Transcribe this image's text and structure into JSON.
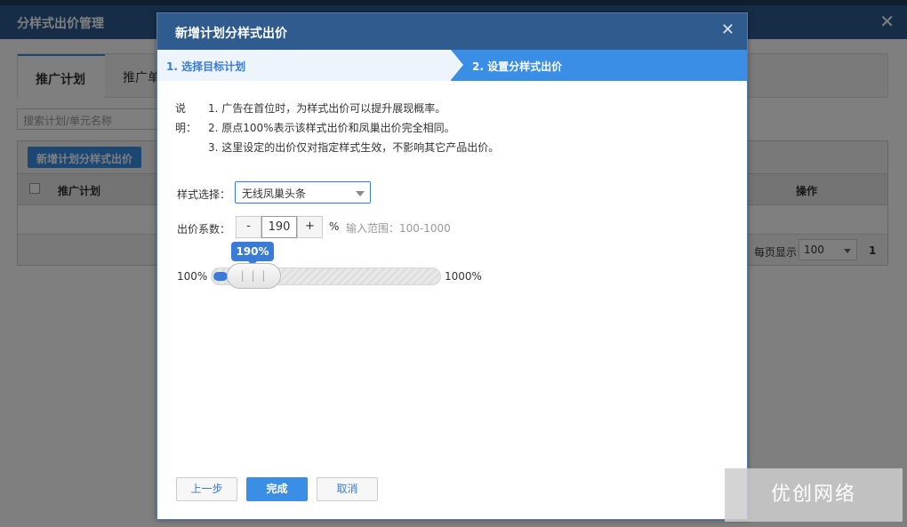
{
  "background": {
    "header_title": "分样式出价管理",
    "close_glyph": "✕",
    "tabs": [
      {
        "label": "推广计划"
      },
      {
        "label": "推广单"
      }
    ],
    "search_placeholder": "搜索计划/单元名称",
    "add_button_label": "新增计划分样式出价",
    "columns": [
      "推广计划",
      "操作"
    ],
    "per_page_label": "每页显示",
    "per_page_value": "100",
    "page_number": "1"
  },
  "modal": {
    "title": "新增计划分样式出价",
    "close_glyph": "✕",
    "steps": [
      {
        "label": "1. 选择目标计划",
        "active": false
      },
      {
        "label": "2. 设置分样式出价",
        "active": true
      }
    ],
    "description": {
      "head": "说明：",
      "lines": [
        "1. 广告在首位时，为样式出价可以提升展现概率。",
        "2. 原点100%表示该样式出价和凤巢出价完全相同。",
        "3. 这里设定的出价仅对指定样式生效，不影响其它产品出价。"
      ]
    },
    "style_select": {
      "label": "样式选择：",
      "value": "无线凤巢头条"
    },
    "bid_coefficient": {
      "label": "出价系数：",
      "minus": "-",
      "value": "190",
      "plus": "+",
      "unit": "%",
      "range_hint": "输入范围：100-1000"
    },
    "slider": {
      "tooltip": "190%",
      "min_label": "100%",
      "max_label": "1000%",
      "handle_grip": "| | |",
      "level_percent": 190
    },
    "buttons": {
      "prev": "上一步",
      "done": "完成",
      "cancel": "取消"
    }
  },
  "watermark": "优创网络",
  "colors": {
    "header": "#2f5b8f",
    "accent": "#3a8ee6",
    "step_inactive_bg": "#eef4fb"
  }
}
